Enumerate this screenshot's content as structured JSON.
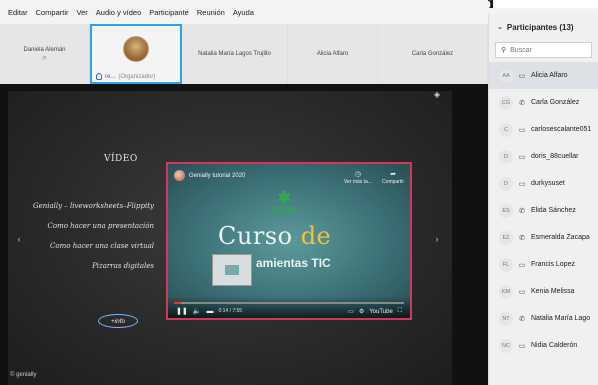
{
  "menu": [
    "Editar",
    "Compartir",
    "Ver",
    "Audio y vídeo",
    "Participante",
    "Reunión",
    "Ayuda"
  ],
  "top_peek": "ng",
  "video_strip": {
    "tiles": [
      {
        "name": "Daniela Alemán",
        "sub": "jo"
      },
      {
        "active": true,
        "caption": "re...",
        "role": "(Organizador)"
      },
      {
        "name": "Natalia María Lagos Trujillo"
      },
      {
        "name": "Alicia Alfaro"
      },
      {
        "name": "Carla González"
      }
    ]
  },
  "slide": {
    "title": "VÍDEO",
    "lines": [
      "Genially – liveworksheets–Flippity",
      "Como hacer una presentación",
      "Como hacer una clase virtual",
      "Pizarras digitales"
    ],
    "info_label": "+info",
    "nav_left": "‹",
    "nav_right": "›",
    "bottom_logo": "© genially"
  },
  "video": {
    "channel_title": "Genially tutorial 2020",
    "actions": [
      {
        "icon": "clock-icon",
        "glyph": "◷",
        "label": "Ver más ta..."
      },
      {
        "icon": "share-icon",
        "glyph": "➦",
        "label": "Compartir"
      }
    ],
    "logo_text": "SENA",
    "title_main": "Curso ",
    "title_accent": "de",
    "subtitle": "amientas TIC",
    "time": "0:14 / 7:55",
    "progress_fraction": 0.03,
    "youtube_label": "YouTube"
  },
  "participants": {
    "header": "Participantes (13)",
    "search_placeholder": "Buscar",
    "list": [
      {
        "initials": "AA",
        "device": "desktop-icon",
        "glyph": "▭",
        "name": "Alicia Alfaro",
        "selected": true
      },
      {
        "initials": "CG",
        "device": "phone-icon",
        "glyph": "✆",
        "name": "Carla González"
      },
      {
        "initials": "C",
        "device": "desktop-icon",
        "glyph": "▭",
        "name": "carlosescalante051"
      },
      {
        "initials": "D",
        "device": "desktop-icon",
        "glyph": "▭",
        "name": "doris_88cuellar"
      },
      {
        "initials": "D",
        "device": "desktop-icon",
        "glyph": "▭",
        "name": "durkysuset"
      },
      {
        "initials": "ES",
        "device": "phone-icon",
        "glyph": "✆",
        "name": "Elida Sánchez"
      },
      {
        "initials": "EZ",
        "device": "phone-icon",
        "glyph": "✆",
        "name": "Esmeralda Zacapa"
      },
      {
        "initials": "FL",
        "device": "desktop-icon",
        "glyph": "▭",
        "name": "Francis Lopez"
      },
      {
        "initials": "KM",
        "device": "desktop-icon",
        "glyph": "▭",
        "name": "Kenia Melissa"
      },
      {
        "initials": "NT",
        "device": "phone-icon",
        "glyph": "✆",
        "name": "Natalia María Lago"
      },
      {
        "initials": "NC",
        "device": "desktop-icon",
        "glyph": "▭",
        "name": "Nidia Calderón"
      }
    ]
  }
}
